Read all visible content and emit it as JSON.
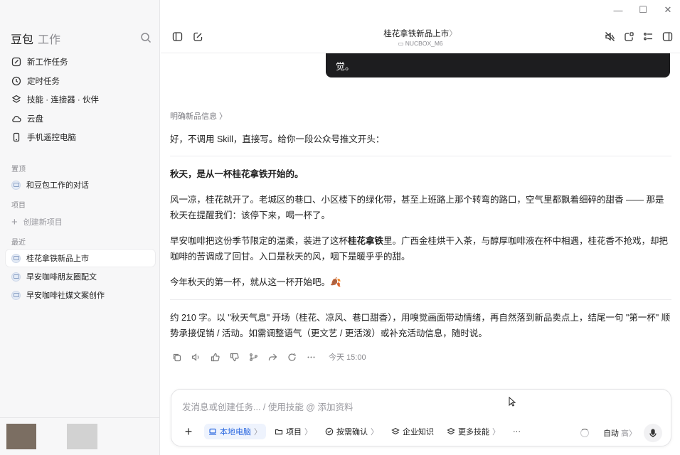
{
  "sidebar": {
    "brand_primary": "豆包",
    "brand_secondary": "工作",
    "menu": [
      {
        "label": "新工作任务",
        "icon": "edit-icon"
      },
      {
        "label": "定时任务",
        "icon": "clock-icon"
      },
      {
        "label": "技能 · 连接器 · 伙伴",
        "icon": "layers-icon"
      },
      {
        "label": "云盘",
        "icon": "cloud-icon"
      },
      {
        "label": "手机遥控电脑",
        "icon": "phone-icon"
      }
    ],
    "pinned_label": "置顶",
    "pinned_items": [
      {
        "label": "和豆包工作的对话"
      }
    ],
    "projects_label": "项目",
    "new_project_label": "创建新项目",
    "recent_label": "最近",
    "recent_items": [
      {
        "label": "桂花拿铁新品上市",
        "active": true
      },
      {
        "label": "早安咖啡朋友圈配文",
        "active": false
      },
      {
        "label": "早安咖啡社媒文案创作",
        "active": false
      }
    ]
  },
  "header": {
    "title": "桂花拿铁新品上市",
    "title_chevron": "〉",
    "device": "NUCBOX_M6"
  },
  "chat": {
    "user_bubble_text": "觉。",
    "clarify_link": "明确新品信息 〉",
    "intro": "好，不调用 Skill，直接写。给你一段公众号推文开头：",
    "article_title": "秋天，是从一杯桂花拿铁开始的。",
    "para1": "风一凉，桂花就开了。老城区的巷口、小区楼下的绿化带，甚至上班路上那个转弯的路口，空气里都飘着细碎的甜香 —— 那是秋天在提醒我们：该停下来，喝一杯了。",
    "para2_a": "早安咖啡把这份季节限定的温柔，装进了这杯",
    "para2_bold": "桂花拿铁",
    "para2_b": "里。广西金桂烘干入茶，与醇厚咖啡液在杯中相遇，桂花香不抢戏，却把咖啡的苦调成了回甘。入口是秋天的风，咽下是暖乎乎的甜。",
    "para3": "今年秋天的第一杯，就从这一杯开始吧。🍂",
    "summary": "约 210 字。以 \"秋天气息\" 开场（桂花、凉风、巷口甜香），用嗅觉画面带动情绪，再自然落到新品卖点上，结尾一句 \"第一杯\" 顺势承接促销 / 活动。如需调整语气（更文艺 / 更活泼）或补充活动信息，随时说。",
    "timestamp": "今天 15:00"
  },
  "composer": {
    "placeholder": "发消息或创建任务... / 使用技能 @ 添加资料",
    "tools": [
      {
        "label": "本地电脑",
        "icon": "laptop-icon"
      },
      {
        "label": "项目",
        "icon": "folder-icon"
      },
      {
        "label": "按需确认",
        "icon": "check-circle-icon"
      },
      {
        "label": "企业知识",
        "icon": "stack-icon"
      },
      {
        "label": "更多技能",
        "icon": "stack-icon"
      }
    ],
    "more": "···",
    "mode_label": "自动",
    "mode_level": "高",
    "chevron": "〉"
  },
  "colors": {
    "accent": "#2d6ae0",
    "sidebar_bg": "#f7f7f8",
    "bubble_bg": "#1d1d1f"
  }
}
